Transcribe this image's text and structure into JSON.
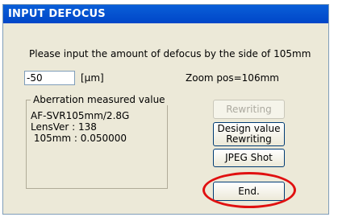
{
  "dialog": {
    "title": "INPUT DEFOCUS",
    "prompt": "Please input the amount of defocus by the side of  105mm",
    "defocus_value": "-50",
    "unit": "[μm]",
    "zoom_label": "Zoom pos=106mm",
    "aberration": {
      "legend": "Aberration measured value",
      "lines": [
        "AF-SVR105mm/2.8G",
        "LensVer : 138",
        " 105mm : 0.050000"
      ]
    },
    "buttons": {
      "rewriting": "Rewriting",
      "design_line1": "Design value",
      "design_line2": "Rewriting",
      "jpeg": "JPEG Shot",
      "end": "End."
    },
    "highlight_color": "#e01010"
  }
}
